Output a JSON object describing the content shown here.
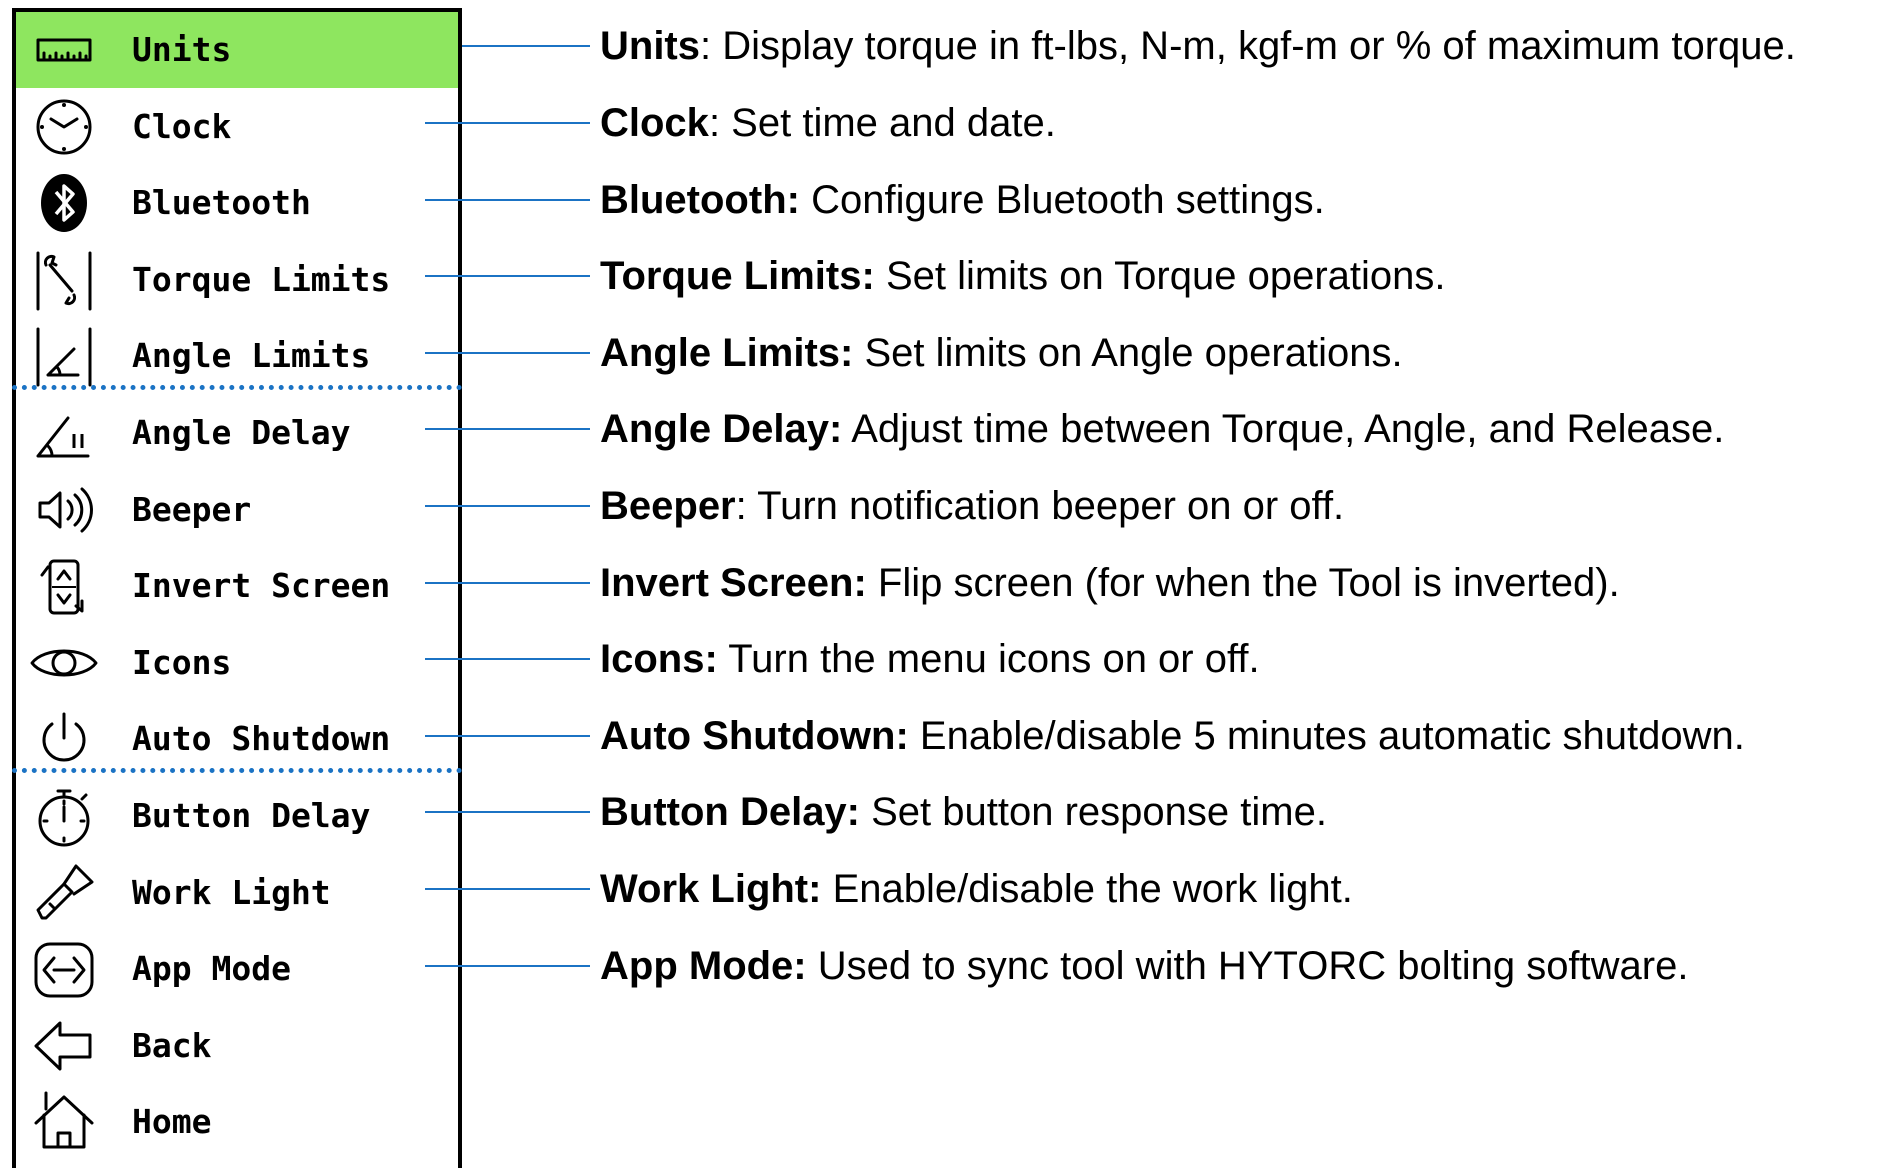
{
  "menu": {
    "items": [
      {
        "id": "units",
        "label": "Units",
        "icon": "ruler-icon",
        "selected": true
      },
      {
        "id": "clock",
        "label": "Clock",
        "icon": "clock-icon"
      },
      {
        "id": "bluetooth",
        "label": "Bluetooth",
        "icon": "bluetooth-icon"
      },
      {
        "id": "torque-limits",
        "label": "Torque Limits",
        "icon": "wrench-icon"
      },
      {
        "id": "angle-limits",
        "label": "Angle Limits",
        "icon": "angle-icon"
      },
      {
        "id": "angle-delay",
        "label": "Angle Delay",
        "icon": "angle-pause-icon"
      },
      {
        "id": "beeper",
        "label": "Beeper",
        "icon": "speaker-icon"
      },
      {
        "id": "invert-screen",
        "label": "Invert Screen",
        "icon": "invert-screen-icon"
      },
      {
        "id": "icons",
        "label": "Icons",
        "icon": "eye-icon"
      },
      {
        "id": "auto-shutdown",
        "label": "Auto Shutdown",
        "icon": "power-icon"
      },
      {
        "id": "button-delay",
        "label": "Button Delay",
        "icon": "stopwatch-icon"
      },
      {
        "id": "work-light",
        "label": "Work Light",
        "icon": "flashlight-icon"
      },
      {
        "id": "app-mode",
        "label": "App Mode",
        "icon": "app-mode-icon"
      },
      {
        "id": "back",
        "label": "Back",
        "icon": "back-arrow-icon"
      },
      {
        "id": "home",
        "label": "Home",
        "icon": "home-icon"
      }
    ]
  },
  "descriptions": [
    {
      "term": "Units",
      "sep": ": ",
      "text": "Display torque in ft-lbs, N-m, kgf-m or % of maximum torque."
    },
    {
      "term": "Clock",
      "sep": ": ",
      "text": "Set time and date."
    },
    {
      "term": "Bluetooth:",
      "sep": " ",
      "text": "Configure Bluetooth settings."
    },
    {
      "term": "Torque Limits:",
      "sep": " ",
      "text": "Set limits on Torque operations."
    },
    {
      "term": "Angle Limits:",
      "sep": " ",
      "text": "Set limits on Angle operations."
    },
    {
      "term": "Angle Delay:",
      "sep": " ",
      "text": "Adjust time between Torque, Angle, and Release."
    },
    {
      "term": "Beeper",
      "sep": ": ",
      "text": "Turn notification beeper on or off."
    },
    {
      "term": "Invert Screen:",
      "sep": " ",
      "text": "Flip screen (for when the Tool is inverted)."
    },
    {
      "term": "Icons:",
      "sep": " ",
      "text": "Turn the menu icons on or off."
    },
    {
      "term": "Auto Shutdown:",
      "sep": " ",
      "text": "Enable/disable 5 minutes automatic shutdown."
    },
    {
      "term": "Button Delay:",
      "sep": " ",
      "text": "Set button response time."
    },
    {
      "term": "Work Light:",
      "sep": " ",
      "text": "Enable/disable the work light."
    },
    {
      "term": "App Mode:",
      "sep": " ",
      "text": "Used to sync tool with HYTORC bolting software."
    }
  ],
  "colors": {
    "selected": "#8ee65f",
    "leader": "#1b73c4",
    "separator": "#1b73c4"
  }
}
